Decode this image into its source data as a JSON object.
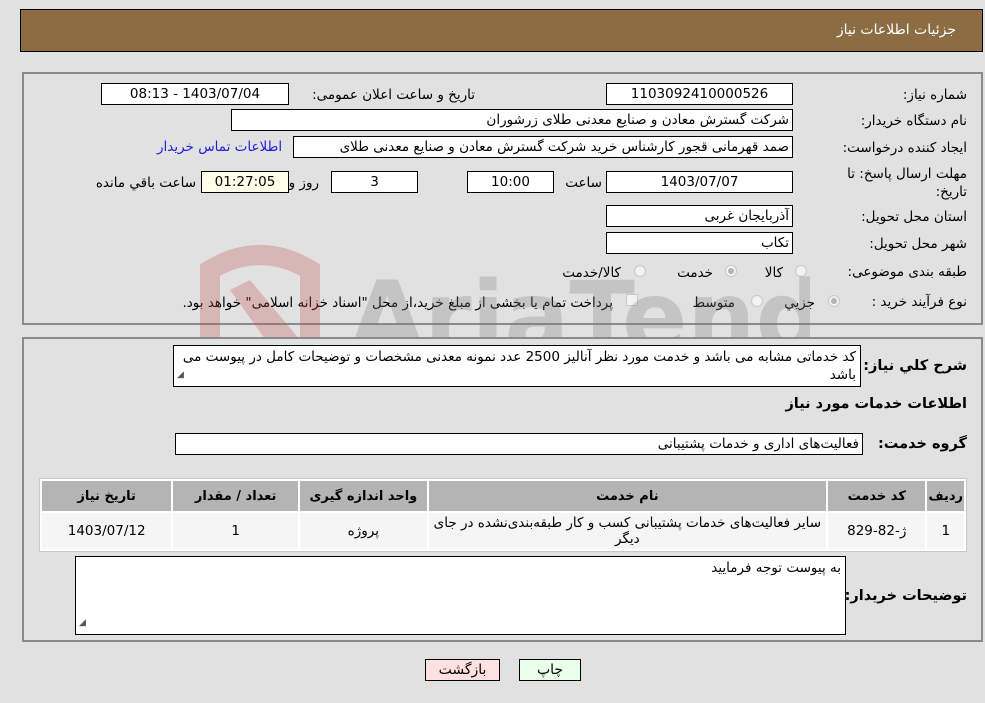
{
  "header": {
    "title": "جزئیات اطلاعات نیاز"
  },
  "fields": {
    "need_number_label": "شماره نیاز:",
    "need_number": "1103092410000526",
    "announce_label": "تاریخ و ساعت اعلان عمومی:",
    "announce_value": "1403/07/04 - 08:13",
    "buyer_org_label": "نام دستگاه خریدار:",
    "buyer_org": "شرکت گسترش معادن و صنایع معدنی طلای زرشوران",
    "creator_label": "ایجاد کننده درخواست:",
    "creator": "صمد قهرمانی قجور کارشناس خرید شرکت گسترش معادن و صنایع معدنی طلای",
    "contact_link": "اطلاعات تماس خریدار",
    "deadline_label": "مهلت ارسال پاسخ: تا تاریخ:",
    "deadline_date": "1403/07/07",
    "time_label": "ساعت",
    "deadline_time": "10:00",
    "days_value": "3",
    "days_label": "روز و",
    "remaining_time": "01:27:05",
    "remaining_label": "ساعت باقي مانده",
    "province_label": "استان محل تحویل:",
    "province": "آذربایجان غربی",
    "city_label": "شهر محل تحویل:",
    "city": "تکاب",
    "category_label": "طبقه بندی موضوعی:",
    "category_options": [
      {
        "label": "کالا",
        "checked": false
      },
      {
        "label": "خدمت",
        "checked": true
      },
      {
        "label": "کالا/خدمت",
        "checked": false
      }
    ],
    "purchase_type_label": "نوع فرآیند خرید :",
    "purchase_options": [
      {
        "label": "جزيي",
        "checked": true
      },
      {
        "label": "متوسط",
        "checked": false
      }
    ],
    "treasury_note": "پرداخت تمام یا بخشی از مبلغ خرید،از محل \"اسناد خزانه اسلامی\" خواهد بود."
  },
  "description": {
    "label": "شرح کلي نیاز:",
    "text": "کد خدماتی مشابه می باشد و خدمت مورد نظر آنالیز 2500 عدد نمونه معدنی مشخصات و توضیحات کامل در پیوست می باشد"
  },
  "services_section": {
    "title": "اطلاعات خدمات مورد نیاز",
    "group_label": "گروه خدمت:",
    "group_value": "فعالیت‌های اداری و خدمات پشتیبانی"
  },
  "table": {
    "headers": [
      "ردیف",
      "کد خدمت",
      "نام خدمت",
      "واحد اندازه گیری",
      "تعداد / مقدار",
      "تاریخ نیاز"
    ],
    "rows": [
      [
        "1",
        "ژ-82-829",
        "سایر فعالیت‌های خدمات پشتیبانی کسب و کار طبقه‌بندی‌نشده در جای دیگر",
        "پروژه",
        "1",
        "1403/07/12"
      ]
    ]
  },
  "buyer_notes": {
    "label": "توضیحات خریدار:",
    "text": "به پیوست توجه فرمایید"
  },
  "buttons": {
    "print": "چاپ",
    "back": "بازگشت"
  },
  "colors": {
    "header_bg": "#8c6d43",
    "print_bg": "#eaffea",
    "back_bg": "#ffe1e1",
    "link": "#1e1ed8"
  }
}
